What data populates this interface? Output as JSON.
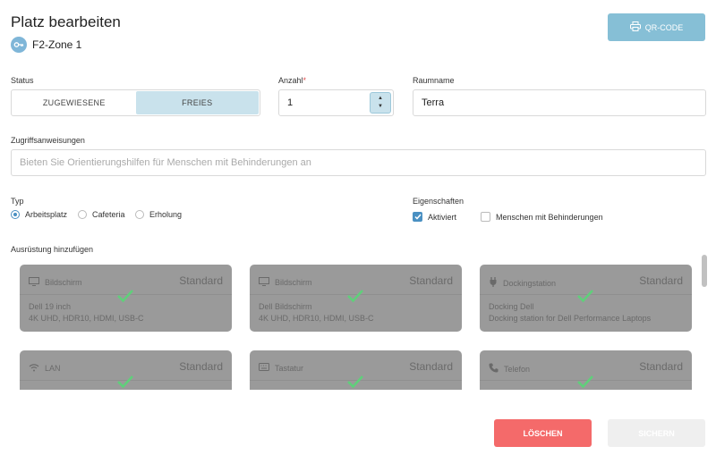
{
  "header": {
    "title": "Platz bearbeiten",
    "zone_label": "F2-Zone 1",
    "qr_button_label": "QR-CODE"
  },
  "status": {
    "label": "Status",
    "options": [
      "ZUGEWIESENE",
      "FREIES"
    ],
    "selected": "FREIES"
  },
  "anzahl": {
    "label": "Anzahl",
    "required_mark": "*",
    "value": "1"
  },
  "raumname": {
    "label": "Raumname",
    "value": "Terra"
  },
  "zugriff": {
    "label": "Zugriffsanweisungen",
    "placeholder": "Bieten Sie Orientierungshilfen für Menschen mit Behinderungen an"
  },
  "typ": {
    "label": "Typ",
    "options": [
      "Arbeitsplatz",
      "Cafeteria",
      "Erholung"
    ],
    "selected": "Arbeitsplatz"
  },
  "eigenschaften": {
    "label": "Eigenschaften",
    "options": [
      {
        "label": "Aktiviert",
        "checked": true
      },
      {
        "label": "Menschen mit Behinderungen",
        "checked": false
      }
    ]
  },
  "equipment": {
    "label": "Ausrüstung hinzufügen",
    "cards": [
      {
        "icon": "monitor-icon",
        "name": "Bildschirm",
        "badge": "Standard",
        "line1": "Dell 19 inch",
        "line2": "4K UHD, HDR10, HDMI, USB-C",
        "checked": true
      },
      {
        "icon": "monitor-icon",
        "name": "Bildschirm",
        "badge": "Standard",
        "line1": "Dell Bildschirm",
        "line2": "4K UHD, HDR10, HDMI, USB-C",
        "checked": true
      },
      {
        "icon": "plug-icon",
        "name": "Dockingstation",
        "badge": "Standard",
        "line1": "Docking Dell",
        "line2": "Docking station for Dell Performance Laptops",
        "checked": true
      },
      {
        "icon": "wifi-icon",
        "name": "LAN",
        "badge": "Standard",
        "line1": "",
        "line2": "",
        "checked": true
      },
      {
        "icon": "keyboard-icon",
        "name": "Tastatur",
        "badge": "Standard",
        "line1": "",
        "line2": "",
        "checked": true
      },
      {
        "icon": "phone-icon",
        "name": "Telefon",
        "badge": "Standard",
        "line1": "",
        "line2": "",
        "checked": true
      }
    ]
  },
  "actions": {
    "delete_label": "LÖSCHEN",
    "save_label": "SICHERN"
  },
  "colors": {
    "accent": "#86bfd6",
    "danger": "#f46a6a",
    "check": "#5fd07a",
    "card": "#9a9a9a"
  }
}
